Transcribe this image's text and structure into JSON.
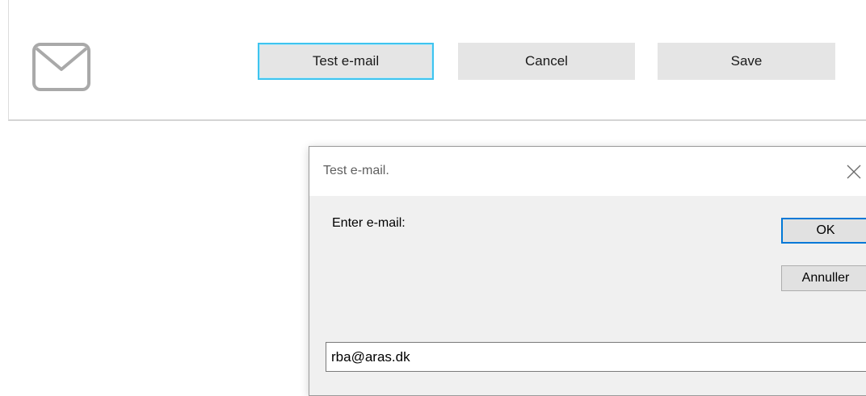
{
  "toolbar": {
    "icon": "mail-icon",
    "test_email_label": "Test e-mail",
    "cancel_label": "Cancel",
    "save_label": "Save",
    "accent_focus": "#3fc4ef"
  },
  "dialog": {
    "title": "Test e-mail.",
    "close_icon": "close-icon",
    "prompt": "Enter e-mail:",
    "ok_label": "OK",
    "cancel_label": "Annuller",
    "email_value": "rba@aras.dk",
    "default_button_color": "#0078d7"
  }
}
